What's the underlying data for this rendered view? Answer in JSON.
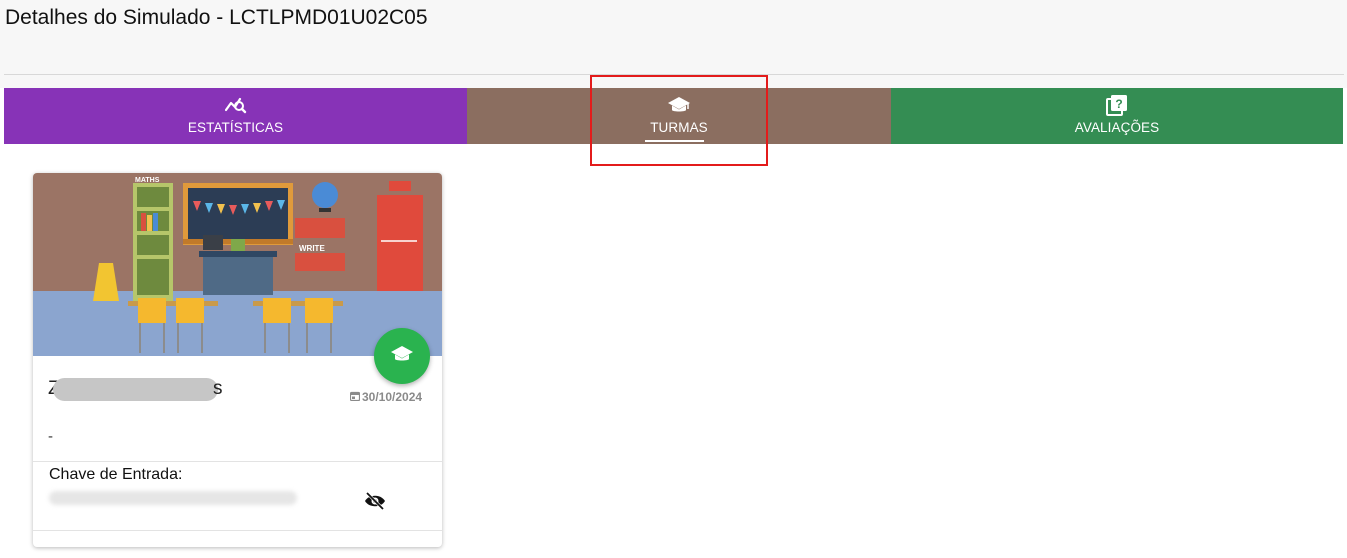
{
  "page": {
    "title": "Detalhes do Simulado - LCTLPMD01U02C05"
  },
  "tabs": [
    {
      "label": "ESTATÍSTICAS",
      "icon": "analytics-icon",
      "color": "#8733b7"
    },
    {
      "label": "TURMAS",
      "icon": "graduation-cap-icon",
      "color": "#8b6e60",
      "active": true
    },
    {
      "label": "AVALIAÇÕES",
      "icon": "quiz-book-icon",
      "color": "#348d53"
    }
  ],
  "card": {
    "image_labels": {
      "maths": "MATHS",
      "write": "WRITE",
      "caution": "CAUTION"
    },
    "name_start": "Z",
    "name_end": "s",
    "date": "30/10/2024",
    "description": "-",
    "key_label": "Chave de Entrada:",
    "fab_icon": "graduation-cap-icon",
    "toggle_icon": "eye-off-icon",
    "fab_color": "#2ab34f"
  }
}
